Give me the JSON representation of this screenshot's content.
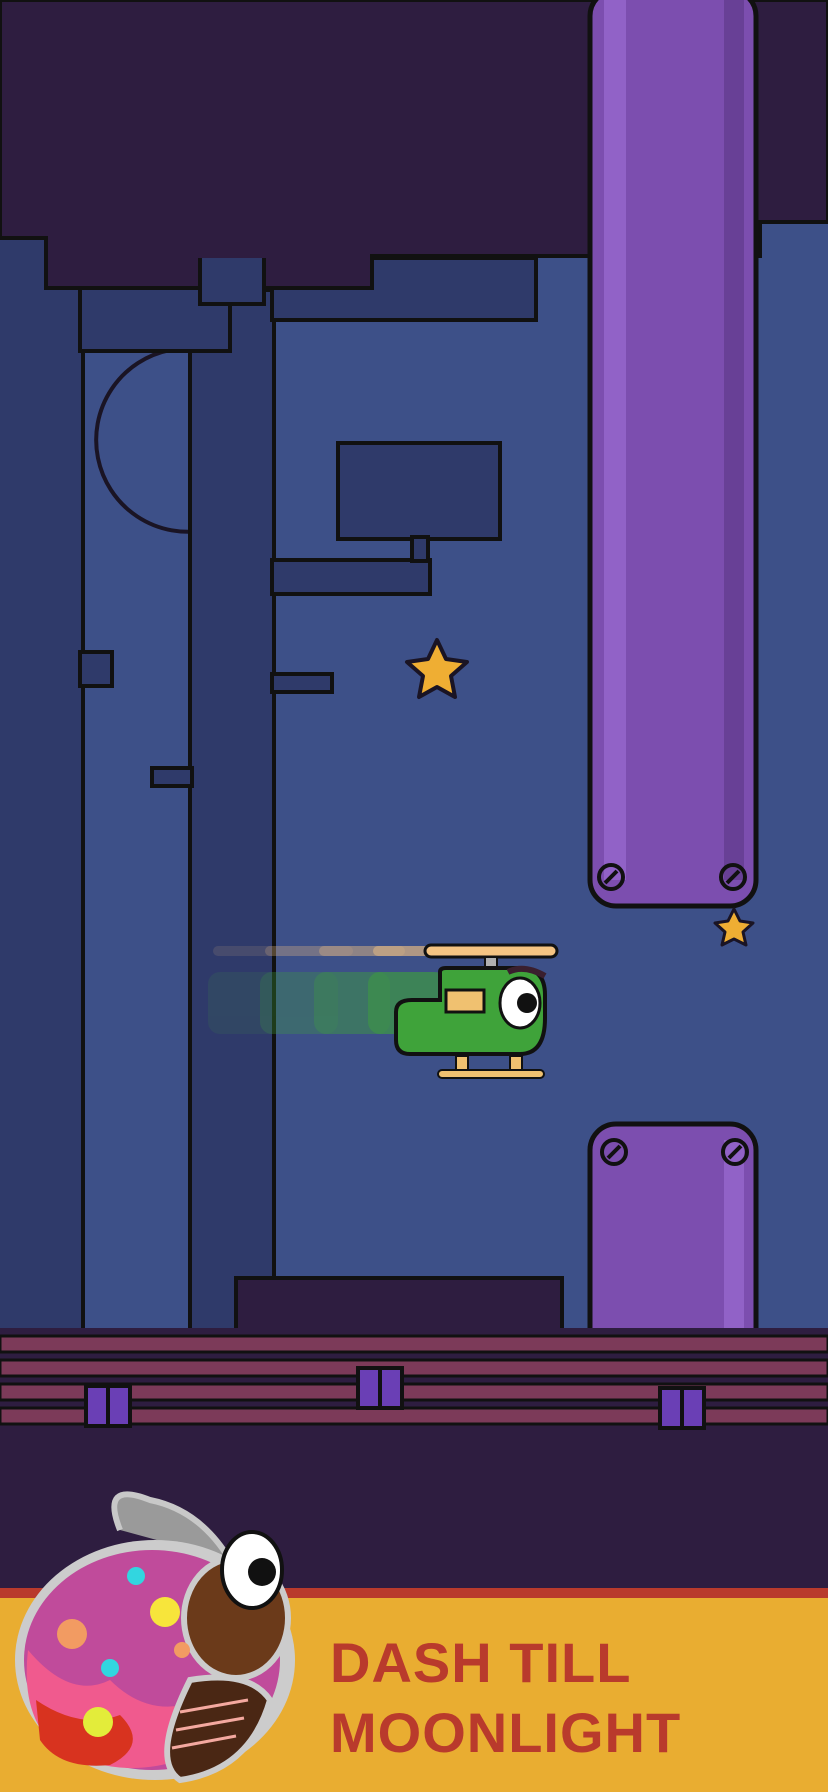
{
  "game": {
    "player": "green-helicopter",
    "collectibles": [
      "star",
      "star"
    ],
    "obstacles": [
      "purple-pipe-top",
      "purple-pipe-bottom"
    ]
  },
  "promo": {
    "line1": "DASH TILL",
    "line2": "MOONLIGHT",
    "mascot": "jelly-bean-bug-icon"
  },
  "colors": {
    "sky": "#3d5088",
    "night_dark": "#2e1d40",
    "pipe": "#7c4eaf",
    "moon": "#efae33",
    "banner": "#e9ad31",
    "banner_text": "#b93a2c"
  }
}
